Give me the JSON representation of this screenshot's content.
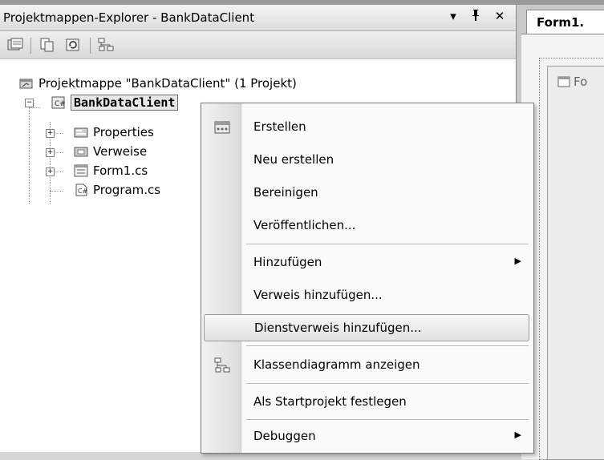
{
  "explorer": {
    "title": "Projektmappen-Explorer - BankDataClient",
    "pin_glyph": "▾",
    "dock_glyph": "ᵽ",
    "close_glyph": "✕"
  },
  "tree": {
    "solution": "Projektmappe \"BankDataClient\" (1 Projekt)",
    "project": "BankDataClient",
    "children": [
      {
        "label": "Properties"
      },
      {
        "label": "Verweise"
      },
      {
        "label": "Form1.cs"
      },
      {
        "label": "Program.cs"
      }
    ]
  },
  "document": {
    "tab_label": "Form1.",
    "form_caption": "Fo"
  },
  "context_menu": {
    "items": [
      {
        "label": "Erstellen"
      },
      {
        "label": "Neu erstellen"
      },
      {
        "label": "Bereinigen"
      },
      {
        "label": "Veröffentlichen..."
      },
      {
        "label": "Hinzufügen"
      },
      {
        "label": "Verweis hinzufügen..."
      },
      {
        "label": "Dienstverweis hinzufügen..."
      },
      {
        "label": "Klassendiagramm anzeigen"
      },
      {
        "label": "Als Startprojekt festlegen"
      },
      {
        "label": "Debuggen"
      }
    ],
    "submenu_arrow": "▶"
  }
}
